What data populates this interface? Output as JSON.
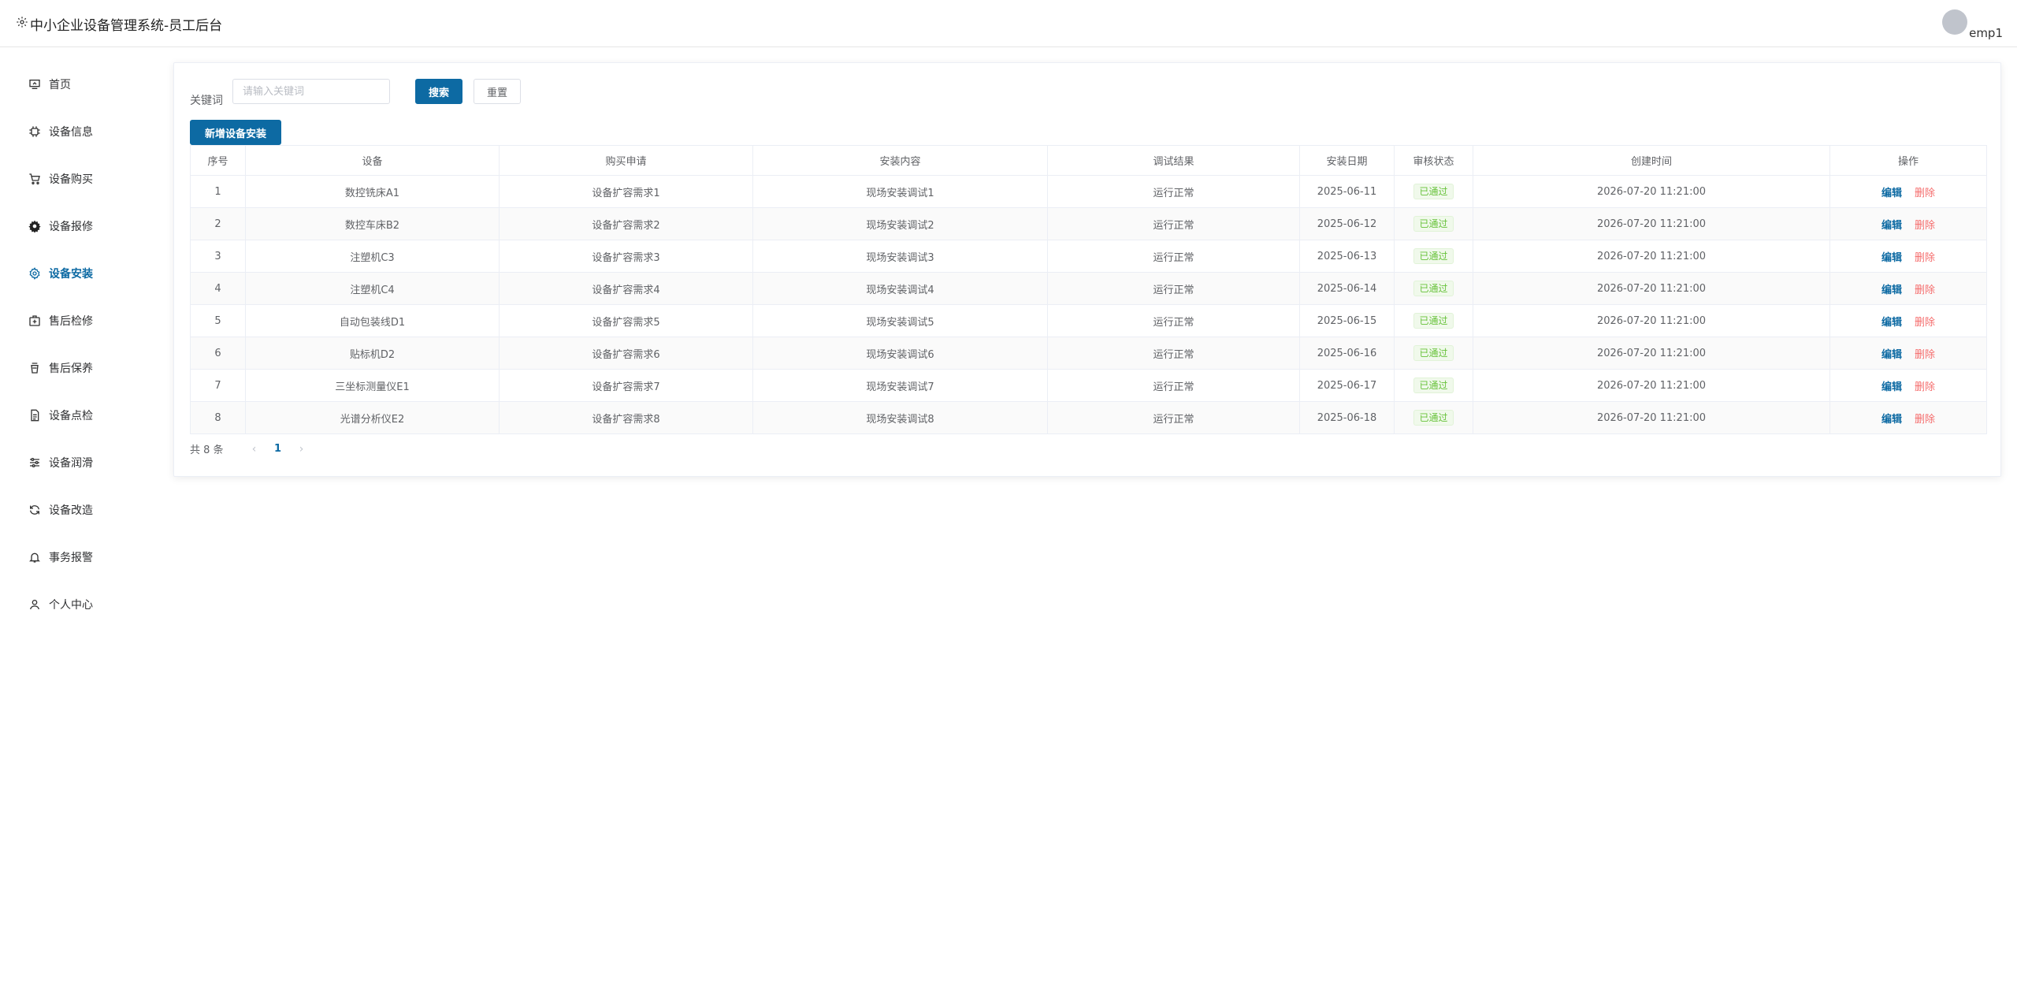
{
  "header": {
    "title": "中小企业设备管理系统-员工后台",
    "username": "emp1"
  },
  "sidebar": {
    "items": [
      {
        "label": "首页",
        "icon": "home-icon"
      },
      {
        "label": "设备信息",
        "icon": "cpu-icon"
      },
      {
        "label": "设备购买",
        "icon": "cart-icon"
      },
      {
        "label": "设备报修",
        "icon": "gear-solid-icon"
      },
      {
        "label": "设备安装",
        "icon": "gear-icon",
        "active": true
      },
      {
        "label": "售后检修",
        "icon": "first-aid-icon"
      },
      {
        "label": "售后保养",
        "icon": "cup-icon"
      },
      {
        "label": "设备点检",
        "icon": "document-icon"
      },
      {
        "label": "设备润滑",
        "icon": "sliders-icon"
      },
      {
        "label": "设备改造",
        "icon": "refresh-icon"
      },
      {
        "label": "事务报警",
        "icon": "bell-icon"
      },
      {
        "label": "个人中心",
        "icon": "user-icon"
      }
    ]
  },
  "filter": {
    "keyword_label": "关键词",
    "keyword_placeholder": "请输入关键词",
    "keyword_value": "",
    "search_label": "搜索",
    "reset_label": "重置"
  },
  "add_button_label": "新增设备安装",
  "table": {
    "columns": [
      "序号",
      "设备",
      "购买申请",
      "安装内容",
      "调试结果",
      "安装日期",
      "审核状态",
      "创建时间",
      "操作"
    ],
    "edit_label": "编辑",
    "delete_label": "删除",
    "rows": [
      [
        "1",
        "数控铣床A1",
        "设备扩容需求1",
        "现场安装调试1",
        "运行正常",
        "2025-06-11",
        "已通过",
        "2026-07-20 11:21:00"
      ],
      [
        "2",
        "数控车床B2",
        "设备扩容需求2",
        "现场安装调试2",
        "运行正常",
        "2025-06-12",
        "已通过",
        "2026-07-20 11:21:00"
      ],
      [
        "3",
        "注塑机C3",
        "设备扩容需求3",
        "现场安装调试3",
        "运行正常",
        "2025-06-13",
        "已通过",
        "2026-07-20 11:21:00"
      ],
      [
        "4",
        "注塑机C4",
        "设备扩容需求4",
        "现场安装调试4",
        "运行正常",
        "2025-06-14",
        "已通过",
        "2026-07-20 11:21:00"
      ],
      [
        "5",
        "自动包装线D1",
        "设备扩容需求5",
        "现场安装调试5",
        "运行正常",
        "2025-06-15",
        "已通过",
        "2026-07-20 11:21:00"
      ],
      [
        "6",
        "贴标机D2",
        "设备扩容需求6",
        "现场安装调试6",
        "运行正常",
        "2025-06-16",
        "已通过",
        "2026-07-20 11:21:00"
      ],
      [
        "7",
        "三坐标测量仪E1",
        "设备扩容需求7",
        "现场安装调试7",
        "运行正常",
        "2025-06-17",
        "已通过",
        "2026-07-20 11:21:00"
      ],
      [
        "8",
        "光谱分析仪E2",
        "设备扩容需求8",
        "现场安装调试8",
        "运行正常",
        "2025-06-18",
        "已通过",
        "2026-07-20 11:21:00"
      ]
    ]
  },
  "pagination": {
    "total_text": "共 8 条",
    "current_page": "1",
    "prev": "‹",
    "next": "›"
  },
  "colors": {
    "primary": "#0d6aa3",
    "danger": "#f56c6c",
    "success": "#67c23a"
  }
}
